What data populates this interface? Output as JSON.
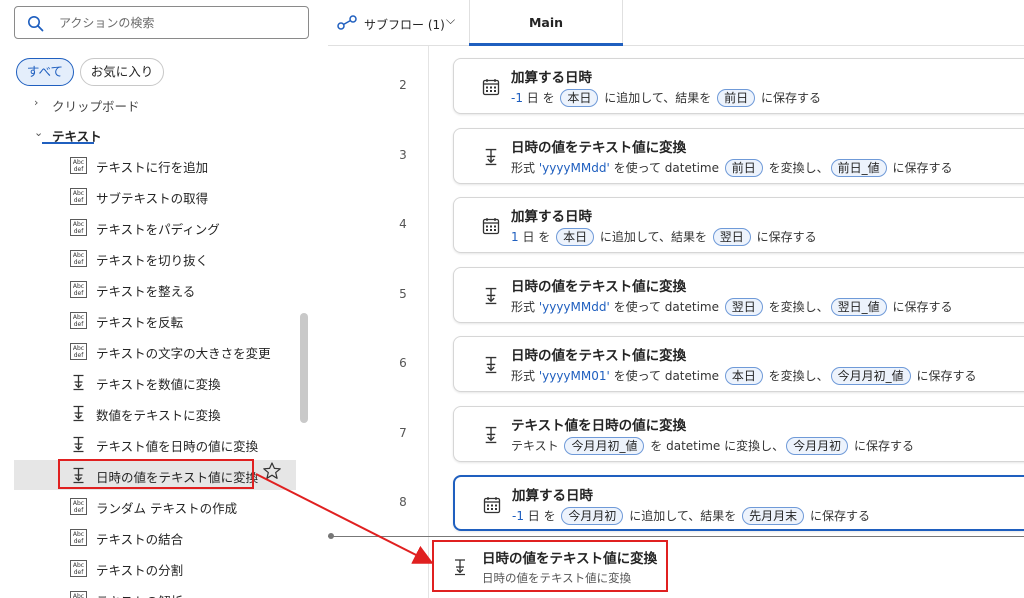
{
  "search": {
    "placeholder": "アクションの検索"
  },
  "filters": {
    "all": "すべて",
    "favorites": "お気に入り"
  },
  "tree": {
    "prev_group_label": "クリップボード",
    "group_label": "テキスト",
    "items": [
      {
        "label": "テキストに行を追加",
        "icon": "abc-def-icon"
      },
      {
        "label": "サブテキストの取得",
        "icon": "abc-def-icon"
      },
      {
        "label": "テキストをパディング",
        "icon": "abc-def-icon"
      },
      {
        "label": "テキストを切り抜く",
        "icon": "abc-def-icon"
      },
      {
        "label": "テキストを整える",
        "icon": "abc-def-icon"
      },
      {
        "label": "テキストを反転",
        "icon": "abc-def-icon"
      },
      {
        "label": "テキストの文字の大きさを変更",
        "icon": "abc-def-icon"
      },
      {
        "label": "テキストを数値に変換",
        "icon": "convert-icon"
      },
      {
        "label": "数値をテキストに変換",
        "icon": "convert-icon"
      },
      {
        "label": "テキスト値を日時の値に変換",
        "icon": "convert-icon"
      },
      {
        "label": "日時の値をテキスト値に変換",
        "icon": "convert-icon",
        "selected": true
      },
      {
        "label": "ランダム テキストの作成",
        "icon": "abc-def-icon"
      },
      {
        "label": "テキストの結合",
        "icon": "abc-def-icon"
      },
      {
        "label": "テキストの分割",
        "icon": "abc-def-icon"
      },
      {
        "label": "テキストの解析",
        "icon": "abc-def-icon"
      }
    ]
  },
  "topbar": {
    "subflow_label": "サブフロー (1)",
    "main_tab": "Main"
  },
  "flow": {
    "steps": [
      {
        "num": "2",
        "icon": "calendar-icon",
        "title": "加算する日時",
        "desc": {
          "lit": "-1",
          "t1": " 日 を ",
          "tok1": "本日",
          "t2": " に追加して、結果を ",
          "tok2": "前日",
          "t3": " に保存する"
        }
      },
      {
        "num": "3",
        "icon": "convert-icon",
        "title": "日時の値をテキスト値に変換",
        "desc": {
          "t0": "形式 ",
          "lit": "'yyyyMMdd'",
          "t1": " を使って datetime ",
          "tok1": "前日",
          "t2": " を変換し、",
          "tok2": "前日_値",
          "t3": " に保存する"
        }
      },
      {
        "num": "4",
        "icon": "calendar-icon",
        "title": "加算する日時",
        "desc": {
          "lit": "1",
          "t1": " 日 を ",
          "tok1": "本日",
          "t2": " に追加して、結果を ",
          "tok2": "翌日",
          "t3": " に保存する"
        }
      },
      {
        "num": "5",
        "icon": "convert-icon",
        "title": "日時の値をテキスト値に変換",
        "desc": {
          "t0": "形式 ",
          "lit": "'yyyyMMdd'",
          "t1": " を使って datetime ",
          "tok1": "翌日",
          "t2": " を変換し、",
          "tok2": "翌日_値",
          "t3": " に保存する"
        }
      },
      {
        "num": "6",
        "icon": "convert-icon",
        "title": "日時の値をテキスト値に変換",
        "desc": {
          "t0": "形式 ",
          "lit": "'yyyyMM01'",
          "t1": " を使って datetime ",
          "tok1": "本日",
          "t2": " を変換し、",
          "tok2": "今月月初_値",
          "t3": " に保存する"
        }
      },
      {
        "num": "7",
        "icon": "convert-icon",
        "title": "テキスト値を日時の値に変換",
        "desc": {
          "t0": "テキスト ",
          "tok1": "今月月初_値",
          "t2": " を datetime に変換し、",
          "tok2": "今月月初",
          "t3": " に保存する"
        }
      },
      {
        "num": "8",
        "icon": "calendar-icon",
        "title": "加算する日時",
        "active": true,
        "desc": {
          "lit": "-1",
          "t1": " 日 を ",
          "tok1": "今月月初",
          "t2": " に追加して、結果を ",
          "tok2": "先月月末",
          "t3": " に保存する"
        }
      }
    ],
    "ghost": {
      "title": "日時の値をテキスト値に変換",
      "subtitle": "日時の値をテキスト値に変換"
    }
  },
  "colors": {
    "accent": "#1f5fbf",
    "highlight": "#e02020",
    "token_bg": "#edf3fc"
  }
}
